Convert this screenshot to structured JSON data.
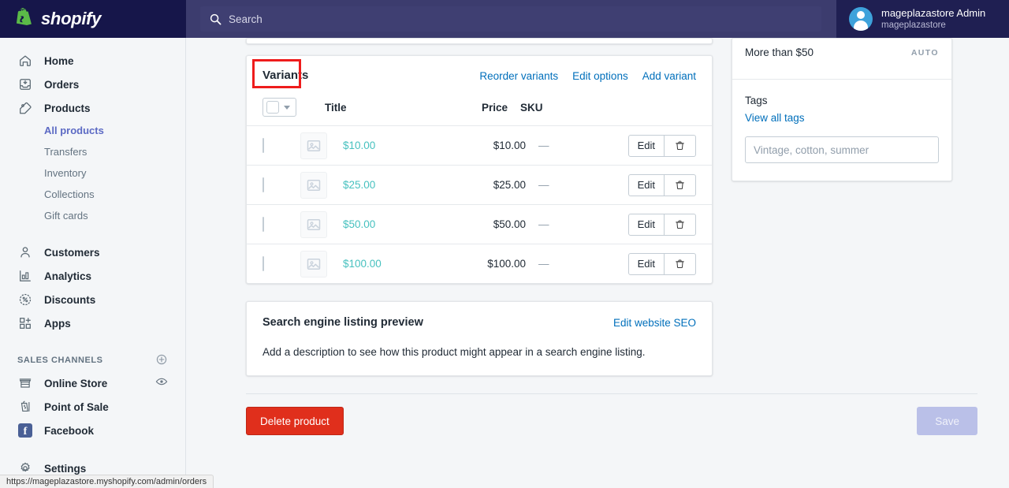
{
  "topbar": {
    "brand": "shopify",
    "search": {
      "placeholder": "Search",
      "icon": "search-icon",
      "value": ""
    },
    "account": {
      "name": "mageplazastore Admin",
      "store": "mageplazastore",
      "avatar_icon": "avatar-person-icon"
    }
  },
  "sidebar": {
    "items": [
      {
        "label": "Home",
        "icon": "home-icon"
      },
      {
        "label": "Orders",
        "icon": "orders-inbox-icon"
      },
      {
        "label": "Products",
        "icon": "products-tag-icon"
      }
    ],
    "product_subitems": [
      {
        "label": "All products",
        "active": true
      },
      {
        "label": "Transfers",
        "active": false
      },
      {
        "label": "Inventory",
        "active": false
      },
      {
        "label": "Collections",
        "active": false
      },
      {
        "label": "Gift cards",
        "active": false
      }
    ],
    "items2": [
      {
        "label": "Customers",
        "icon": "customer-person-icon"
      },
      {
        "label": "Analytics",
        "icon": "analytics-bars-icon"
      },
      {
        "label": "Discounts",
        "icon": "discount-percent-icon"
      },
      {
        "label": "Apps",
        "icon": "apps-grid-plus-icon"
      }
    ],
    "sales_channels_header": "SALES CHANNELS",
    "sales_channels_add_icon": "plus-circle-icon",
    "sales_channels": [
      {
        "label": "Online Store",
        "icon": "online-store-icon",
        "trailing_icon": "eye-icon"
      },
      {
        "label": "Point of Sale",
        "icon": "point-of-sale-icon",
        "trailing_icon": ""
      },
      {
        "label": "Facebook",
        "icon": "facebook-icon",
        "trailing_icon": ""
      }
    ],
    "settings": {
      "label": "Settings",
      "icon": "gear-icon"
    }
  },
  "variants": {
    "title": "Variants",
    "highlight_color": "#ee1c1c",
    "actions": [
      {
        "label": "Reorder variants"
      },
      {
        "label": "Edit options"
      },
      {
        "label": "Add variant"
      }
    ],
    "columns": {
      "title": "Title",
      "price": "Price",
      "sku": "SKU"
    },
    "rows": [
      {
        "title": "$10.00",
        "price": "$10.00",
        "sku": "—",
        "edit": "Edit",
        "delete_icon": "trash-icon",
        "thumb_icon": "image-placeholder-icon"
      },
      {
        "title": "$25.00",
        "price": "$25.00",
        "sku": "—",
        "edit": "Edit",
        "delete_icon": "trash-icon",
        "thumb_icon": "image-placeholder-icon"
      },
      {
        "title": "$50.00",
        "price": "$50.00",
        "sku": "—",
        "edit": "Edit",
        "delete_icon": "trash-icon",
        "thumb_icon": "image-placeholder-icon"
      },
      {
        "title": "$100.00",
        "price": "$100.00",
        "sku": "—",
        "edit": "Edit",
        "delete_icon": "trash-icon",
        "thumb_icon": "image-placeholder-icon"
      }
    ],
    "link_color": "#47c1bf"
  },
  "seo": {
    "title": "Search engine listing preview",
    "edit_link": "Edit website SEO",
    "body": "Add a description to see how this product might appear in a search engine listing."
  },
  "right_panel": {
    "collection_label": "More than $50",
    "collection_badge": "AUTO",
    "tags_label": "Tags",
    "view_all_tags": "View all tags",
    "tags_placeholder": "Vintage, cotton, summer",
    "tags_value": ""
  },
  "footer": {
    "delete_label": "Delete product",
    "save_label": "Save"
  },
  "statusbar": {
    "url": "https://mageplazastore.myshopify.com/admin/orders"
  }
}
